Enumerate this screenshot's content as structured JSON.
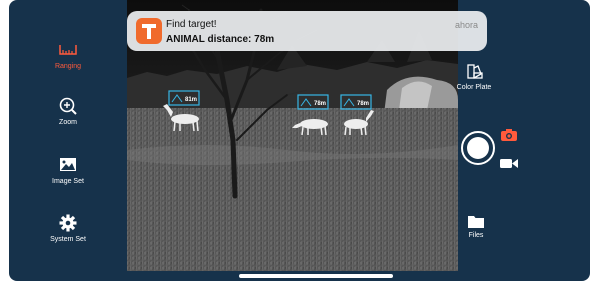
{
  "left_tools": [
    {
      "label": "Ranging",
      "icon": "ranging-icon",
      "active": true
    },
    {
      "label": "Zoom",
      "icon": "zoom-icon",
      "active": false
    },
    {
      "label": "Image Set",
      "icon": "image-icon",
      "active": false
    },
    {
      "label": "System Set",
      "icon": "gear-icon",
      "active": false
    }
  ],
  "right_tools": {
    "color_plate": "Color Plate",
    "files": "Files"
  },
  "notification": {
    "title": "Find target!",
    "body": "ANIMAL distance: 78m",
    "time": "ahora"
  },
  "targets": [
    {
      "distance": "81m"
    },
    {
      "distance": "78m"
    },
    {
      "distance": "78m"
    }
  ],
  "colors": {
    "background": "#16324b",
    "accent": "#ff5a3c",
    "target_box": "#37b6e6"
  }
}
